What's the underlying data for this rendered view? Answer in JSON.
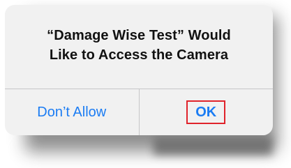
{
  "alert": {
    "title_line1": "“Damage Wise Test” Would",
    "title_line2": "Like to Access the Camera",
    "deny_label": "Don’t Allow",
    "allow_label": "OK"
  },
  "colors": {
    "accent": "#1b7cf3",
    "highlight_box": "#e0232b",
    "alert_background": "#f1f1f1"
  }
}
